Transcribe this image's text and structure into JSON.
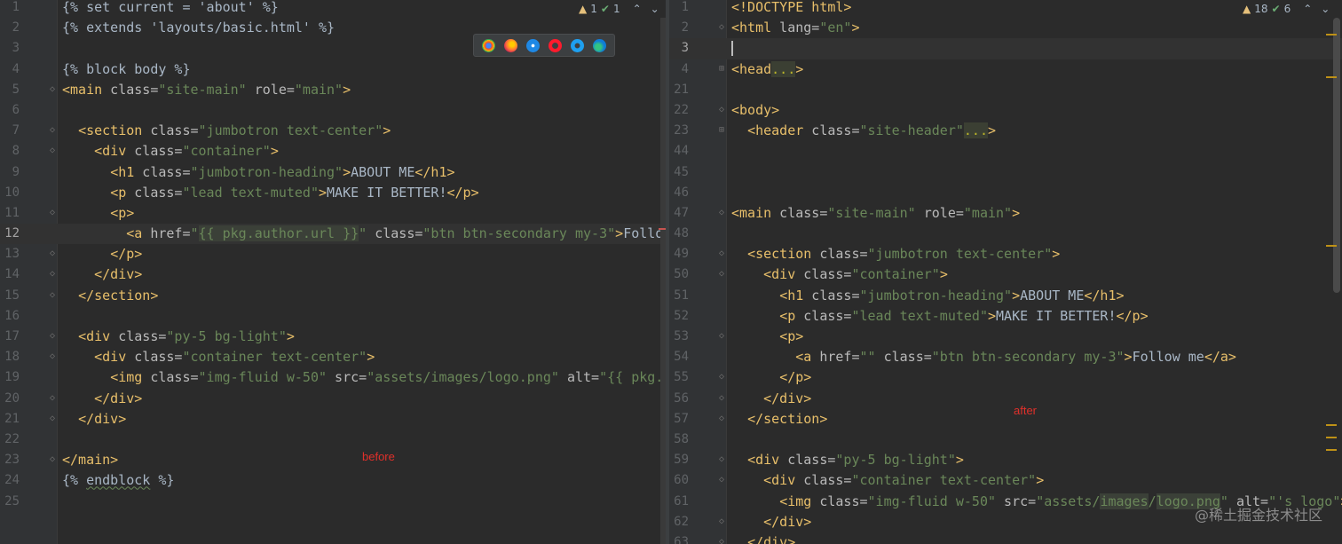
{
  "left_editor": {
    "inspection": {
      "warnings": "1",
      "ok": "1"
    },
    "note": "before",
    "lines": [
      {
        "n": "1"
      },
      {
        "n": "2"
      },
      {
        "n": "3"
      },
      {
        "n": "4"
      },
      {
        "n": "5"
      },
      {
        "n": "6"
      },
      {
        "n": "7"
      },
      {
        "n": "8"
      },
      {
        "n": "9"
      },
      {
        "n": "10"
      },
      {
        "n": "11"
      },
      {
        "n": "12"
      },
      {
        "n": "13"
      },
      {
        "n": "14"
      },
      {
        "n": "15"
      },
      {
        "n": "16"
      },
      {
        "n": "17"
      },
      {
        "n": "18"
      },
      {
        "n": "19"
      },
      {
        "n": "20"
      },
      {
        "n": "21"
      },
      {
        "n": "22"
      },
      {
        "n": "23"
      },
      {
        "n": "24"
      },
      {
        "n": "25"
      }
    ],
    "code": {
      "l1": "{% set current = 'about' %}",
      "l2": "{% extends 'layouts/basic.html' %}",
      "l4": "{% block body %}",
      "l5_tag": "<main",
      "l5_attr1": " class=",
      "l5_val1": "\"site-main\"",
      "l5_attr2": " role=",
      "l5_val2": "\"main\"",
      "l5_end": ">",
      "l7_tag": "<section",
      "l7_attr": " class=",
      "l7_val": "\"jumbotron text-center\"",
      "l7_end": ">",
      "l8_tag": "<div",
      "l8_attr": " class=",
      "l8_val": "\"container\"",
      "l8_end": ">",
      "l9_tag": "<h1",
      "l9_attr": " class=",
      "l9_val": "\"jumbotron-heading\"",
      "l9_gt": ">",
      "l9_text": "ABOUT ME",
      "l9_close": "</h1>",
      "l10_tag": "<p",
      "l10_attr": " class=",
      "l10_val": "\"lead text-muted\"",
      "l10_gt": ">",
      "l10_text": "MAKE IT BETTER!",
      "l10_close": "</p>",
      "l11_tag": "<p>",
      "l12_tag": "<a",
      "l12_attr1": " href=",
      "l12_q1": "\"",
      "l12_tpl": "{{ pkg.author.url }}",
      "l12_q2": "\"",
      "l12_attr2": " class=",
      "l12_val2": "\"btn btn-secondary my-3\"",
      "l12_gt": ">",
      "l12_text": "Follow",
      "l13_tag": "</p>",
      "l14_tag": "</div>",
      "l15_tag": "</section>",
      "l17_tag": "<div",
      "l17_attr": " class=",
      "l17_val": "\"py-5 bg-light\"",
      "l17_end": ">",
      "l18_tag": "<div",
      "l18_attr": " class=",
      "l18_val": "\"container text-center\"",
      "l18_end": ">",
      "l19_tag": "<img",
      "l19_attr1": " class=",
      "l19_val1": "\"img-fluid w-50\"",
      "l19_attr2": " src=",
      "l19_val2": "\"assets/images/logo.png\"",
      "l19_attr3": " alt=",
      "l19_val3": "\"{{ pkg.na",
      "l20_tag": "</div>",
      "l21_tag": "</div>",
      "l23_tag": "</main>",
      "l24_a": "{% ",
      "l24_b": "endblock",
      "l24_c": " %}"
    }
  },
  "right_editor": {
    "inspection": {
      "warnings": "18",
      "ok": "6"
    },
    "note": "after",
    "code": {
      "r1": "<!DOCTYPE html>",
      "r2_tag": "<html",
      "r2_attr": " lang=",
      "r2_val": "\"en\"",
      "r2_end": ">",
      "r4_tag": "<head",
      "r4_fold": "...",
      "r4_end": ">",
      "r22_tag": "<body>",
      "r23_tag": "<header",
      "r23_attr": " class=",
      "r23_val": "\"site-header\"",
      "r23_fold": "...",
      "r23_end": ">",
      "r47_tag": "<main",
      "r47_attr1": " class=",
      "r47_val1": "\"site-main\"",
      "r47_attr2": " role=",
      "r47_val2": "\"main\"",
      "r47_end": ">",
      "r49_tag": "<section",
      "r49_attr": " class=",
      "r49_val": "\"jumbotron text-center\"",
      "r49_end": ">",
      "r50_tag": "<div",
      "r50_attr": " class=",
      "r50_val": "\"container\"",
      "r50_end": ">",
      "r51_tag": "<h1",
      "r51_attr": " class=",
      "r51_val": "\"jumbotron-heading\"",
      "r51_gt": ">",
      "r51_text": "ABOUT ME",
      "r51_close": "</h1>",
      "r52_tag": "<p",
      "r52_attr": " class=",
      "r52_val": "\"lead text-muted\"",
      "r52_gt": ">",
      "r52_text": "MAKE IT BETTER!",
      "r52_close": "</p>",
      "r53_tag": "<p>",
      "r54_tag": "<a",
      "r54_attr1": " href=",
      "r54_val1": "\"\"",
      "r54_attr2": " class=",
      "r54_val2": "\"btn btn-secondary my-3\"",
      "r54_gt": ">",
      "r54_text": "Follow me",
      "r54_close": "</a>",
      "r55_tag": "</p>",
      "r56_tag": "</div>",
      "r57_tag": "</section>",
      "r59_tag": "<div",
      "r59_attr": " class=",
      "r59_val": "\"py-5 bg-light\"",
      "r59_end": ">",
      "r60_tag": "<div",
      "r60_attr": " class=",
      "r60_val": "\"container text-center\"",
      "r60_end": ">",
      "r61_tag": "<img",
      "r61_attr1": " class=",
      "r61_val1": "\"img-fluid w-50\"",
      "r61_attr2": " src=",
      "r61_val2a": "\"assets/",
      "r61_val2b": "images",
      "r61_val2c": "/",
      "r61_val2d": "logo.png",
      "r61_val2e": "\"",
      "r61_attr3": " alt=",
      "r61_val3": "\"'s logo\"",
      "r61_end": ">",
      "r62_tag": "</div>",
      "r63_tag": "</div>"
    },
    "line_numbers": [
      "1",
      "2",
      "3",
      "4",
      "21",
      "22",
      "23",
      "44",
      "45",
      "46",
      "47",
      "48",
      "49",
      "50",
      "51",
      "52",
      "53",
      "54",
      "55",
      "56",
      "57",
      "58",
      "59",
      "60",
      "61",
      "62",
      "63"
    ]
  },
  "watermark": "@稀土掘金技术社区",
  "colors": {
    "background": "#2b2b2b",
    "tag": "#e8bf6a",
    "attribute": "#bababa",
    "string": "#6a8759",
    "text": "#a9b7c6",
    "note": "#e0302b"
  }
}
